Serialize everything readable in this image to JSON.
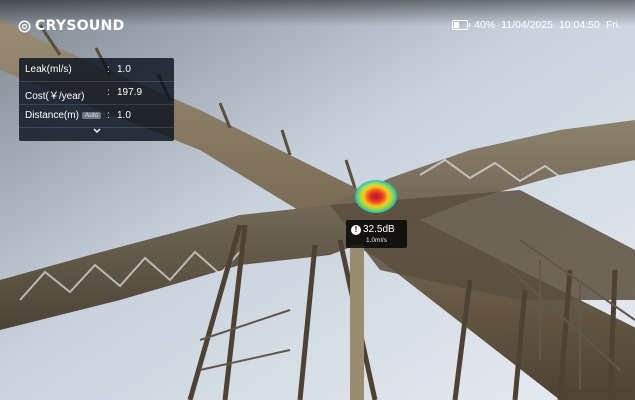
{
  "brand": {
    "name": "CRYSOUND"
  },
  "status": {
    "battery_level": 0.4,
    "battery_text": "40%",
    "date": "11/04/2025",
    "time": "10:04:50",
    "weekday": "Fri."
  },
  "readout_panel": {
    "rows": [
      {
        "label": "Leak(ml/s)",
        "colon": ":",
        "value": "1.0"
      },
      {
        "label": "Cost(￥/year)",
        "colon": ":",
        "value": "197.9"
      },
      {
        "label": "Distance(m)",
        "badge": "Auto",
        "colon": ":",
        "value": "1.0"
      }
    ],
    "expand_icon": "chevron-down-icon"
  },
  "detection": {
    "level_text": "32.5dB",
    "flow_text": "1.0ml/s",
    "info_glyph": "!",
    "heatmap_colors": [
      "#b0146e",
      "#e0241c",
      "#ffd020",
      "#28c8b0",
      "#1a3fd0"
    ]
  },
  "colors": {
    "panel_bg": "#0a121e",
    "sky": "#c9d4df",
    "structure": "#6b5e4a"
  }
}
